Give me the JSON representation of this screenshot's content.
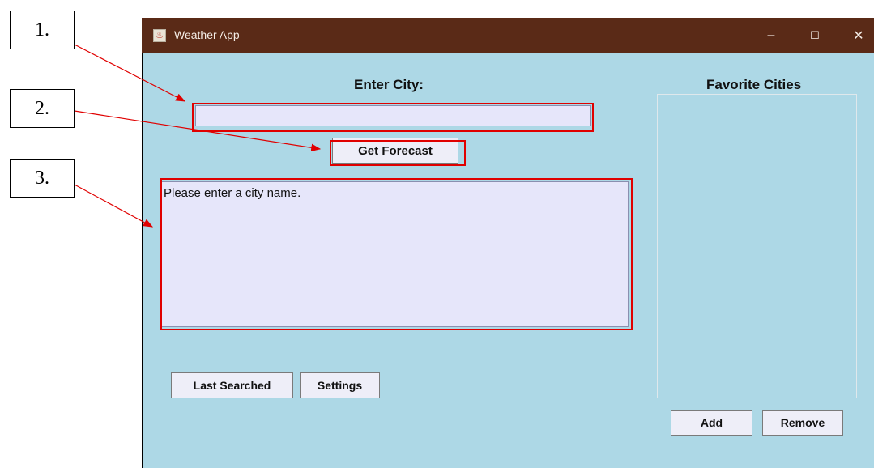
{
  "callouts": [
    "1.",
    "2.",
    "3."
  ],
  "window": {
    "title": "Weather App",
    "controls": {
      "minimize": "–",
      "maximize": "☐",
      "close": "✕"
    }
  },
  "main": {
    "city_label": "Enter City:",
    "city_input_value": "",
    "forecast_button": "Get Forecast",
    "output_text": "Please enter a city name.",
    "last_searched_button": "Last Searched",
    "settings_button": "Settings"
  },
  "favorites": {
    "title": "Favorite Cities",
    "items": [],
    "add_button": "Add",
    "remove_button": "Remove"
  },
  "colors": {
    "titlebar": "#5a2a17",
    "client_bg": "#add8e6",
    "field_bg": "#e6e6fa",
    "annotation": "#e00000"
  }
}
